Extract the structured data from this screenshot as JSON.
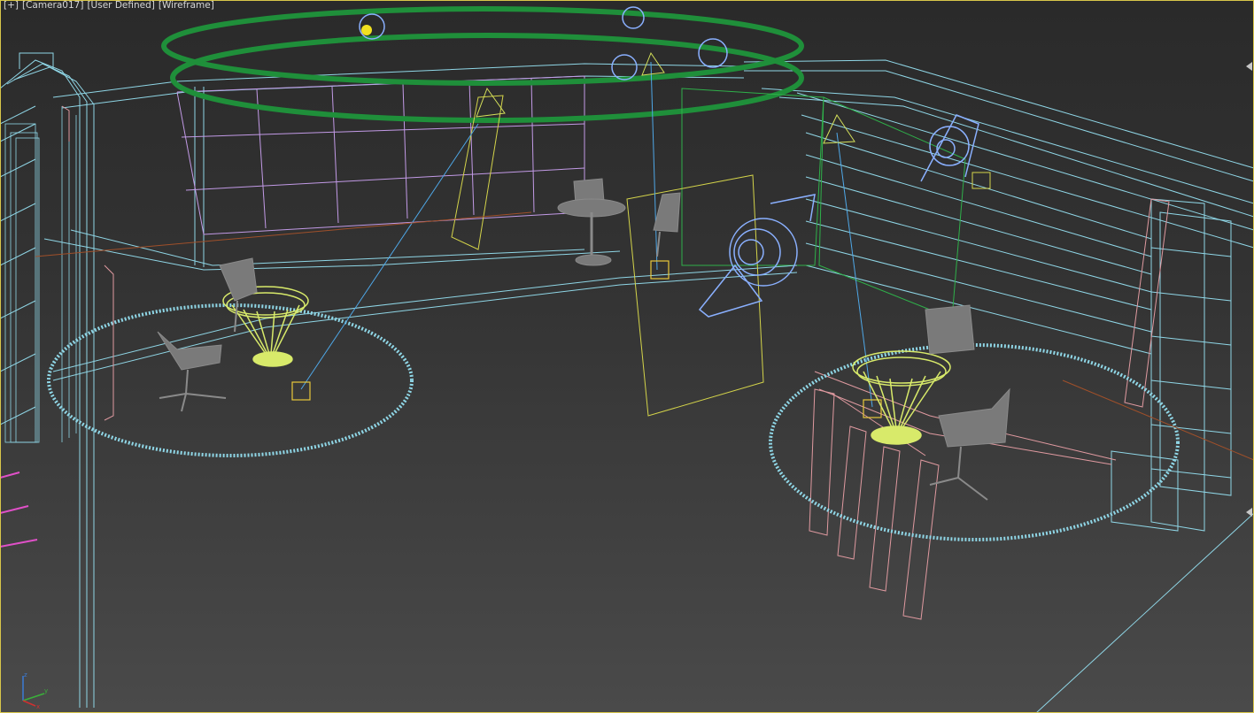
{
  "viewport": {
    "labels": [
      "[+]",
      "[Camera017]",
      "[User Defined]",
      "[Wireframe]"
    ]
  },
  "colors": {
    "background_top": "#2a2a2a",
    "background_bottom": "#4a4a4a",
    "active_border": "#d8c64a",
    "wire_cyan": "#8fd6e6",
    "wire_green": "#1f8f3a",
    "wire_yellow": "#d4e05a",
    "wire_pink": "#e09aa0",
    "wire_purple": "#c29ae6",
    "light_blue": "#8ab0ff",
    "chair_gray": "#7a7a7a",
    "target_yellow": "#e8d23a"
  },
  "axis": {
    "x": "x",
    "y": "y",
    "z": "z"
  }
}
